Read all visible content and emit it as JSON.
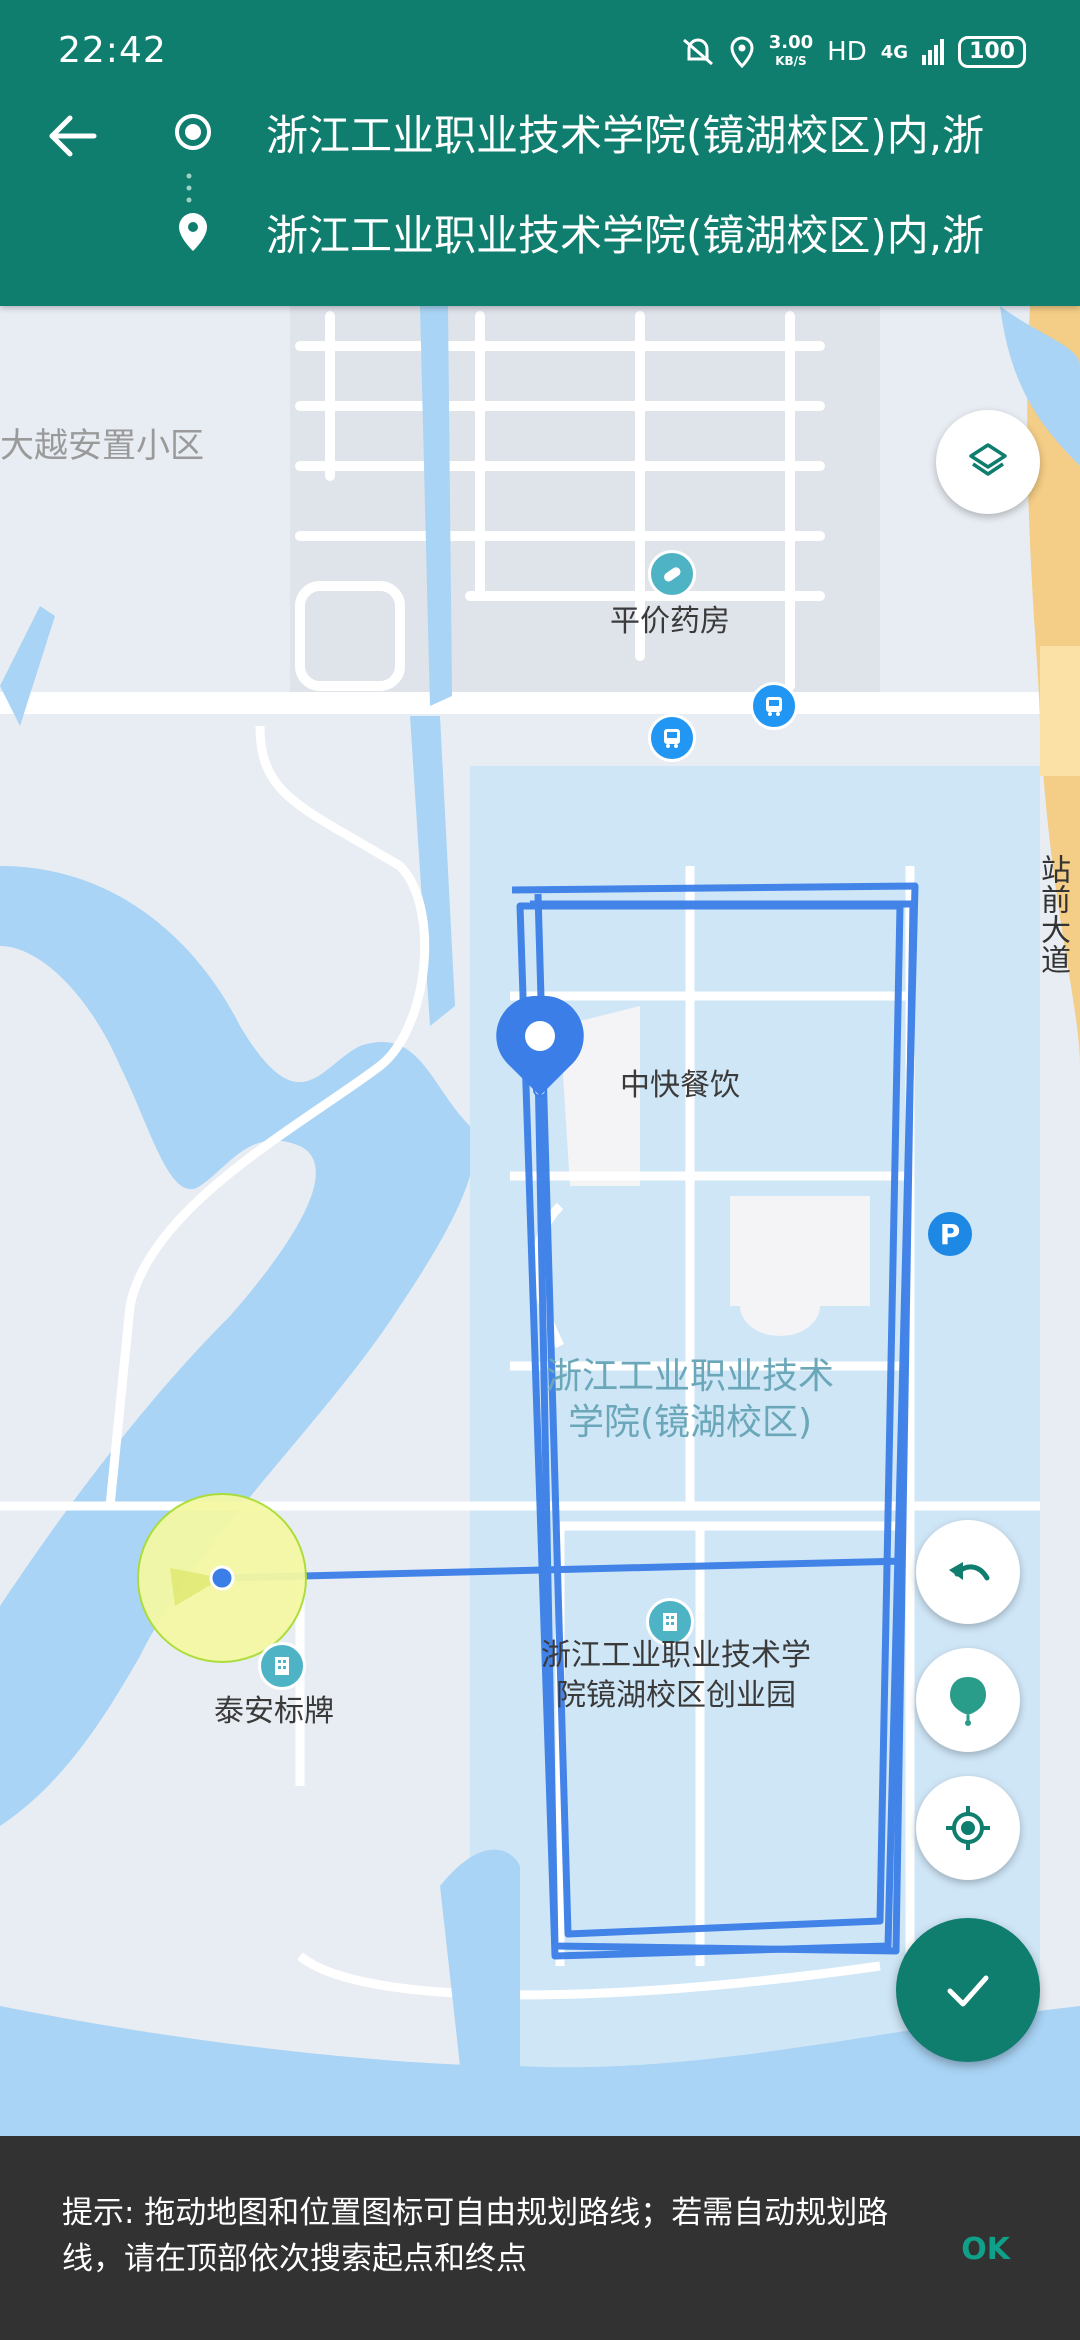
{
  "status_bar": {
    "time": "22:42",
    "network_speed": "3.00",
    "network_speed_unit": "KB/S",
    "hd": "HD",
    "signal": "4G",
    "battery": "100"
  },
  "header": {
    "start": {
      "text": "浙江工业职业技术学院(镜湖校区)内,浙"
    },
    "end": {
      "text": "浙江工业职业技术学院(镜湖校区)内,浙"
    }
  },
  "map": {
    "labels": {
      "yue_area": "大越安置小区",
      "pharmacy": "平价药房",
      "restaurant": "中快餐饮",
      "campus_line1": "浙江工业职业技术",
      "campus_line2": "学院(镜湖校区)",
      "park_line1": "浙江工业职业技术学",
      "park_line2": "院镜湖校区创业园",
      "taian": "泰安标牌",
      "road": "站前大道"
    },
    "parking_label": "P"
  },
  "snackbar": {
    "message": "提示: 拖动地图和位置图标可自由规划路线；若需自动规划路线，请在顶部依次搜索起点和终点",
    "action": "OK"
  },
  "colors": {
    "primary": "#0f7e6e",
    "route": "#3b7ee8",
    "water": "#a9d4f5",
    "campus": "#cfe6f7"
  }
}
